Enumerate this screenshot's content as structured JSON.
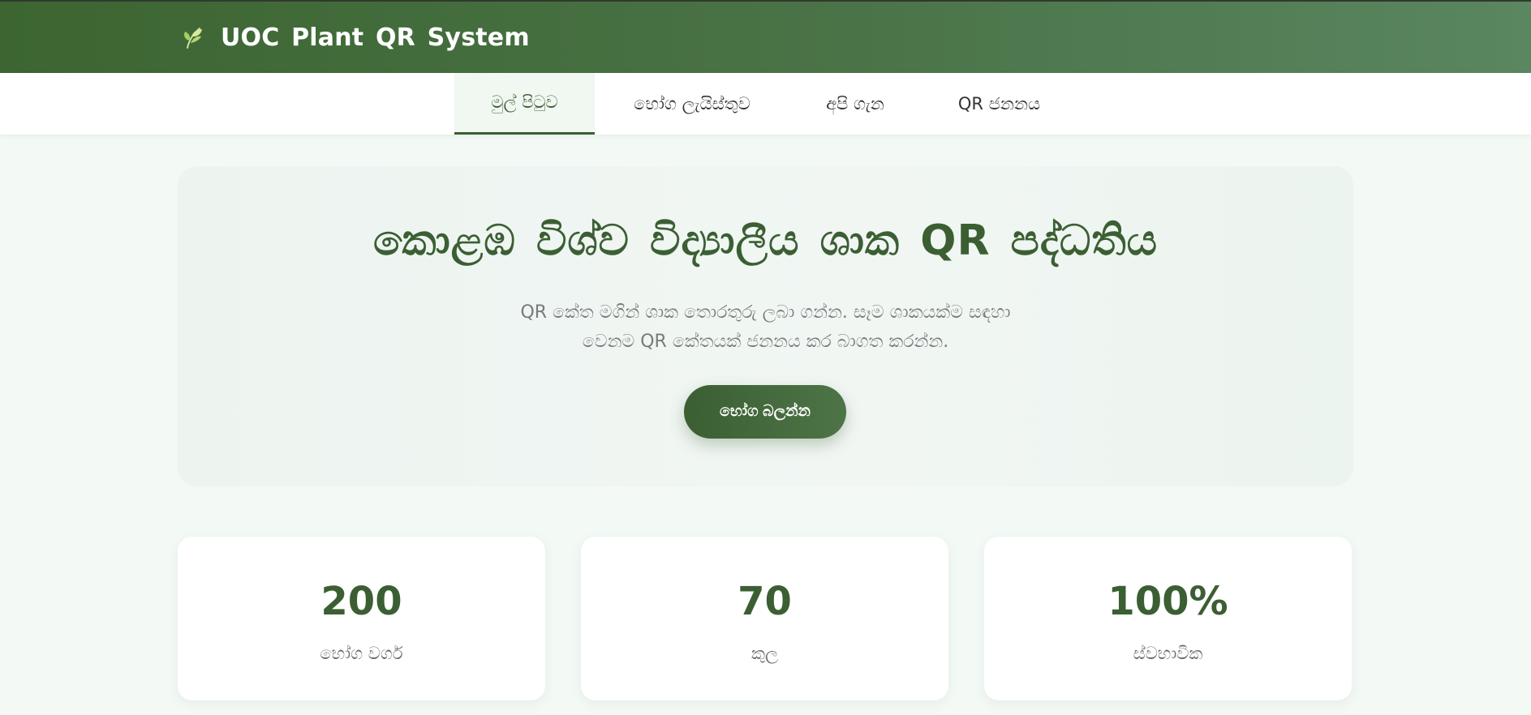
{
  "header": {
    "brand_icon": "leaf-icon",
    "title": "UOC Plant QR System"
  },
  "nav": {
    "items": [
      {
        "label": "මුල් පිටුව",
        "active": true
      },
      {
        "label": "භෝග ලැයිස්තුව",
        "active": false
      },
      {
        "label": "අපි ගැන",
        "active": false
      },
      {
        "label": "QR ජනනය",
        "active": false
      }
    ]
  },
  "hero": {
    "title": "කොළඹ විශ්ව විද්‍යාලීය ශාක QR පද්ධතිය",
    "subtitle_line1": "QR කේත මගින් ශාක තොරතුරු ලබා ගන්න. සෑම ශාකයක්ම සඳහා",
    "subtitle_line2": "වෙනම QR කේතයක් ජනනය කර බාගත කරන්න.",
    "cta_label": "භෝග බලන්න"
  },
  "stats": [
    {
      "value": "200",
      "label": "භෝග වර්ග"
    },
    {
      "value": "70",
      "label": "කුල"
    },
    {
      "value": "100%",
      "label": "ස්වභාවික"
    }
  ],
  "colors": {
    "primary": "#3b5f33",
    "header_gradient_start": "#3c6531",
    "header_gradient_end": "#5a8660",
    "page_background": "#f3faf6",
    "hero_background": "#eef5f1",
    "muted_text": "#7a7a7a"
  }
}
